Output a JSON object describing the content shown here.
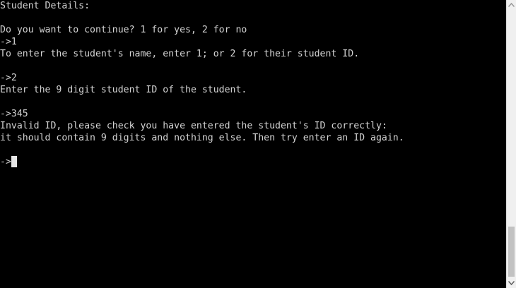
{
  "console": {
    "lines": [
      "Student Details:",
      "",
      "Do you want to continue? 1 for yes, 2 for no",
      "->1",
      "To enter the student's name, enter 1; or 2 for their student ID.",
      "",
      "->2",
      "Enter the 9 digit student ID of the student.",
      "",
      "->345",
      "Invalid ID, please check you have entered the student's ID correctly:",
      "it should contain 9 digits and nothing else. Then try enter an ID again.",
      "",
      "->"
    ],
    "text_color": "#d4d4d4",
    "background_color": "#000000"
  },
  "scrollbar": {
    "up_icon": "scroll-up-arrow-icon",
    "down_icon": "scroll-down-arrow-icon",
    "position_fraction": 0.95
  }
}
